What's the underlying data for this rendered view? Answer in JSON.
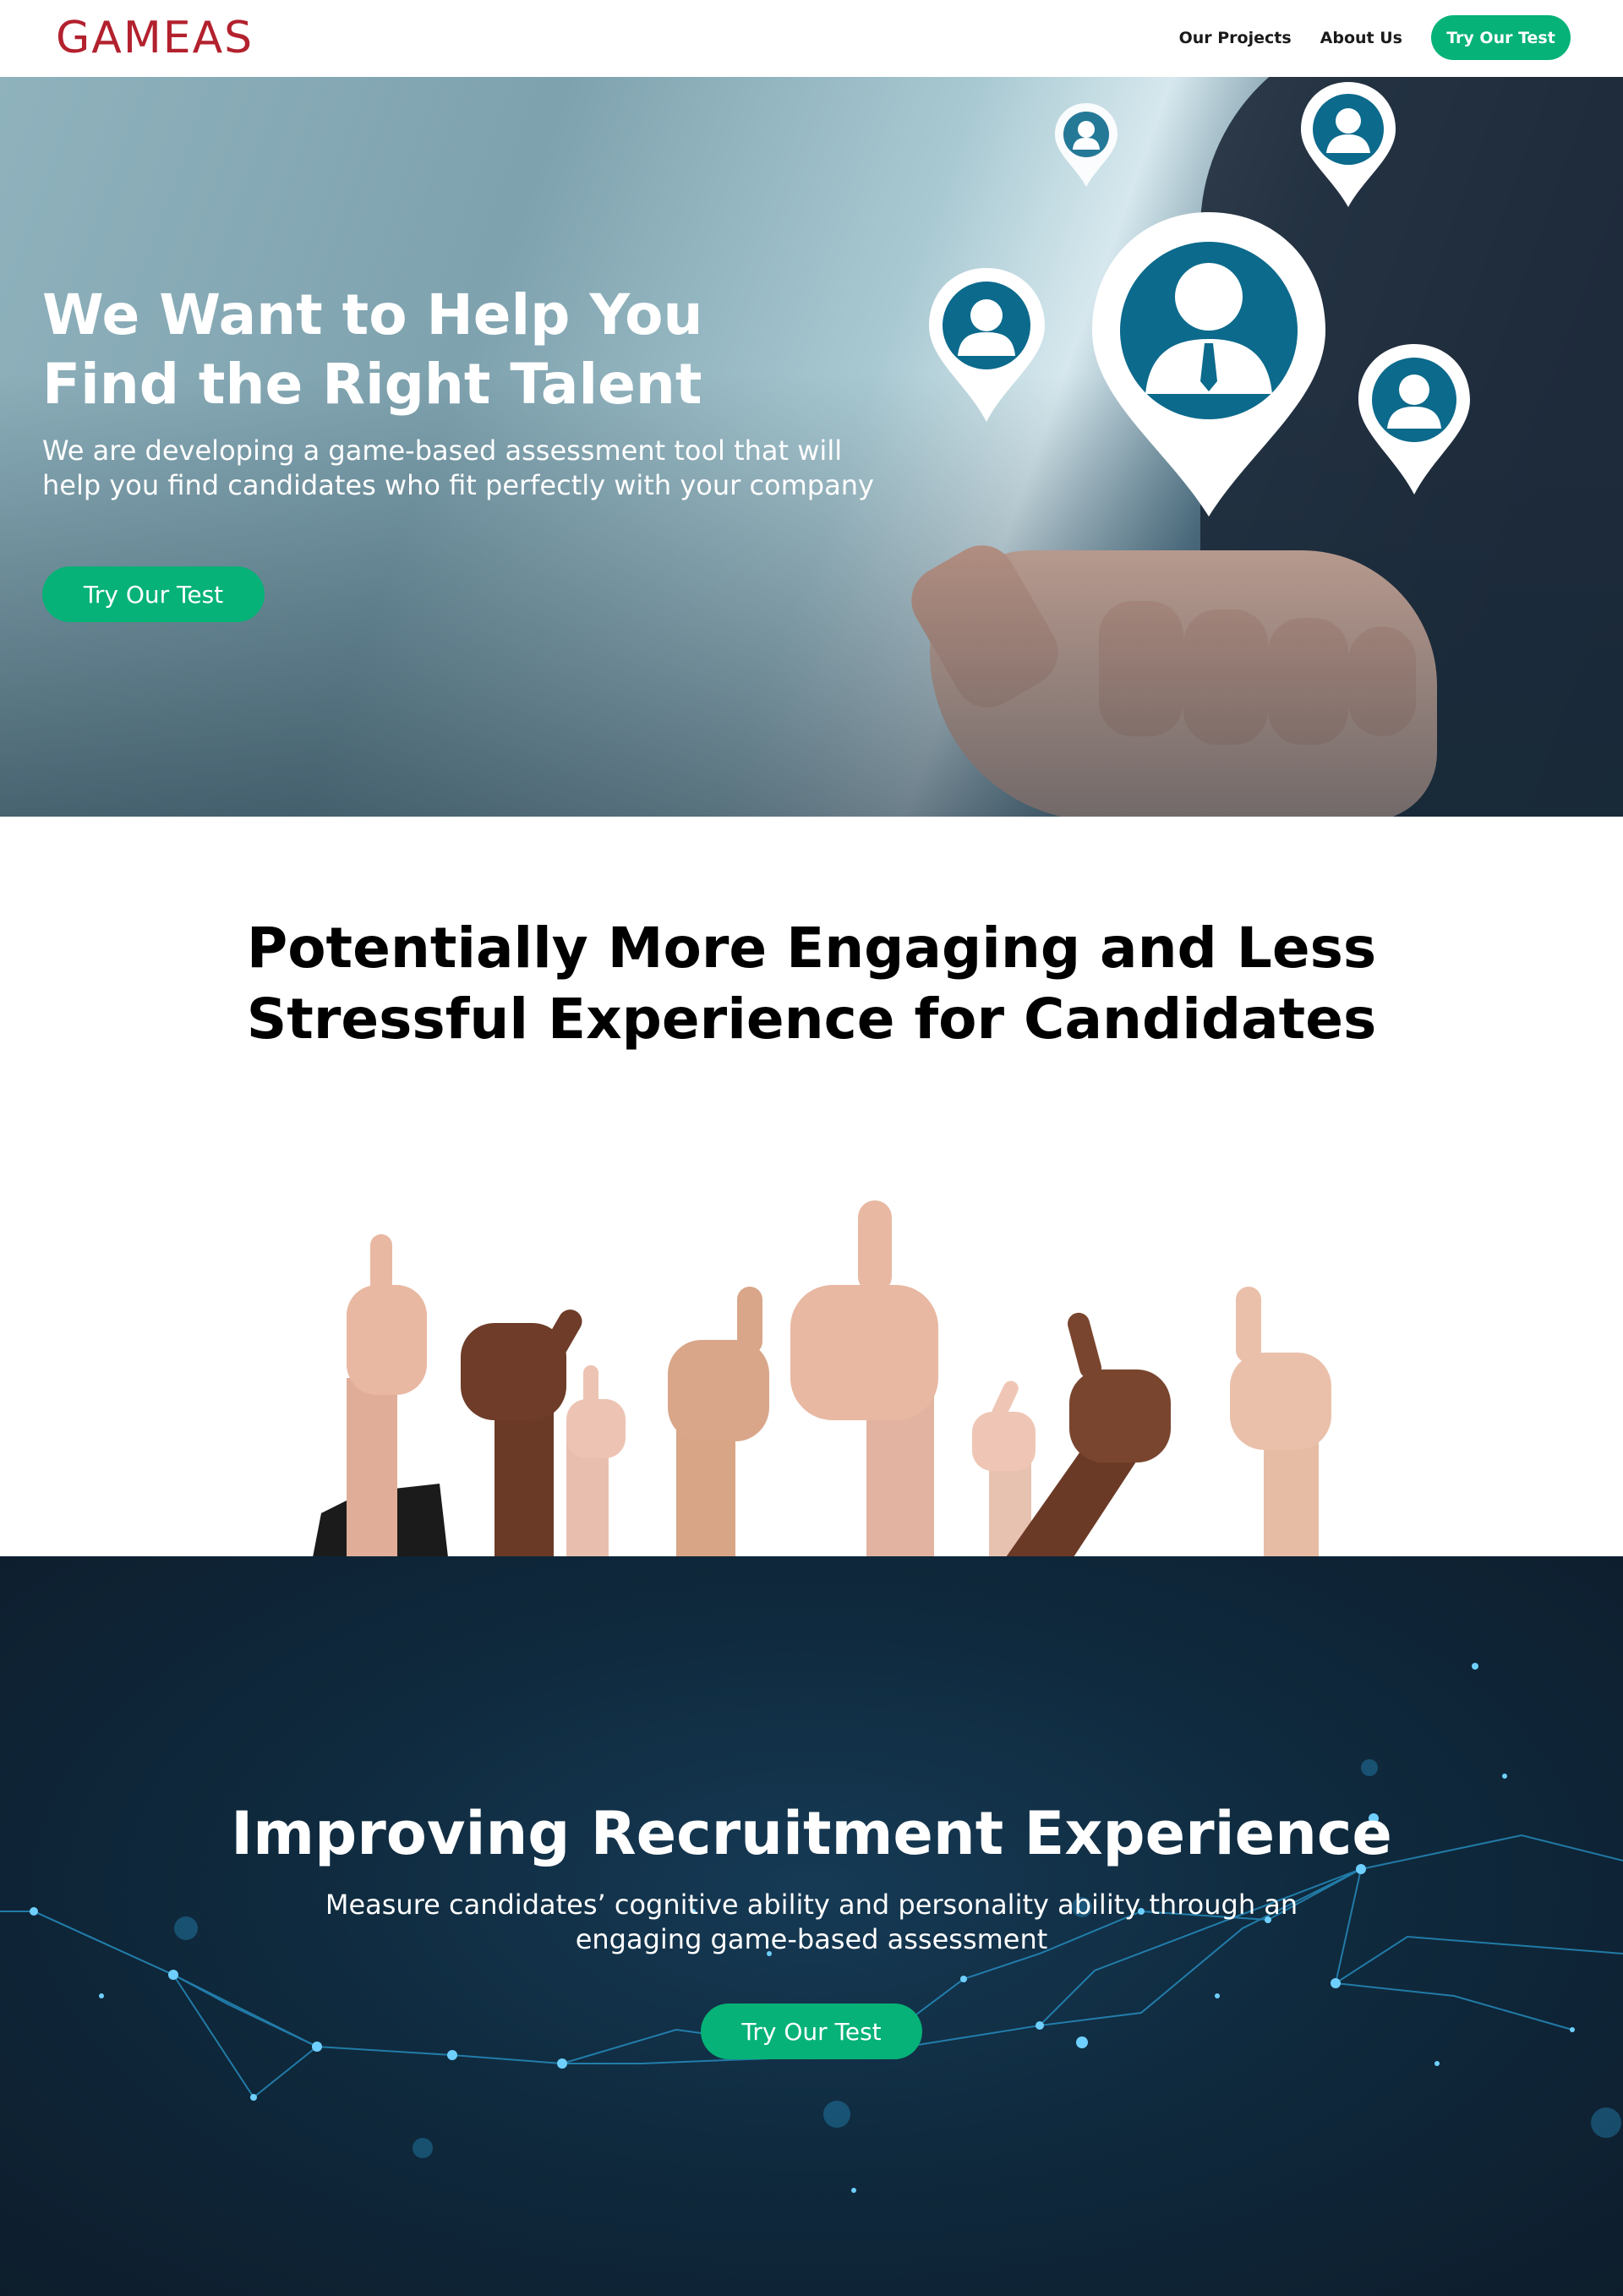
{
  "header": {
    "logo_text": "GAMEAS",
    "nav": [
      "Our Projects",
      "About Us"
    ],
    "cta_label": "Try Our Test"
  },
  "hero": {
    "title_line1": "We Want to Help You",
    "title_line2": "Find the Right Talent",
    "subtitle": "We are developing a game-based assessment tool that will help you find candidates who fit perfectly with your company",
    "cta_label": "Try Our Test",
    "image": "hand-holding-person-location-pins"
  },
  "engage": {
    "title_line1": "Potentially More Engaging and Less",
    "title_line2": "Stressful Experience for Candidates",
    "image": "many-hands-thumbs-up"
  },
  "recruitment": {
    "title": "Improving Recruitment Experience",
    "subtitle": "Measure candidates’ cognitive ability and personality ability through an engaging game-based assessment",
    "cta_label": "Try Our Test",
    "image": "network-nodes-background"
  },
  "colors": {
    "brand": "#b3212e",
    "accent": "#06b277",
    "dark_bg": "#0f2a3e"
  }
}
